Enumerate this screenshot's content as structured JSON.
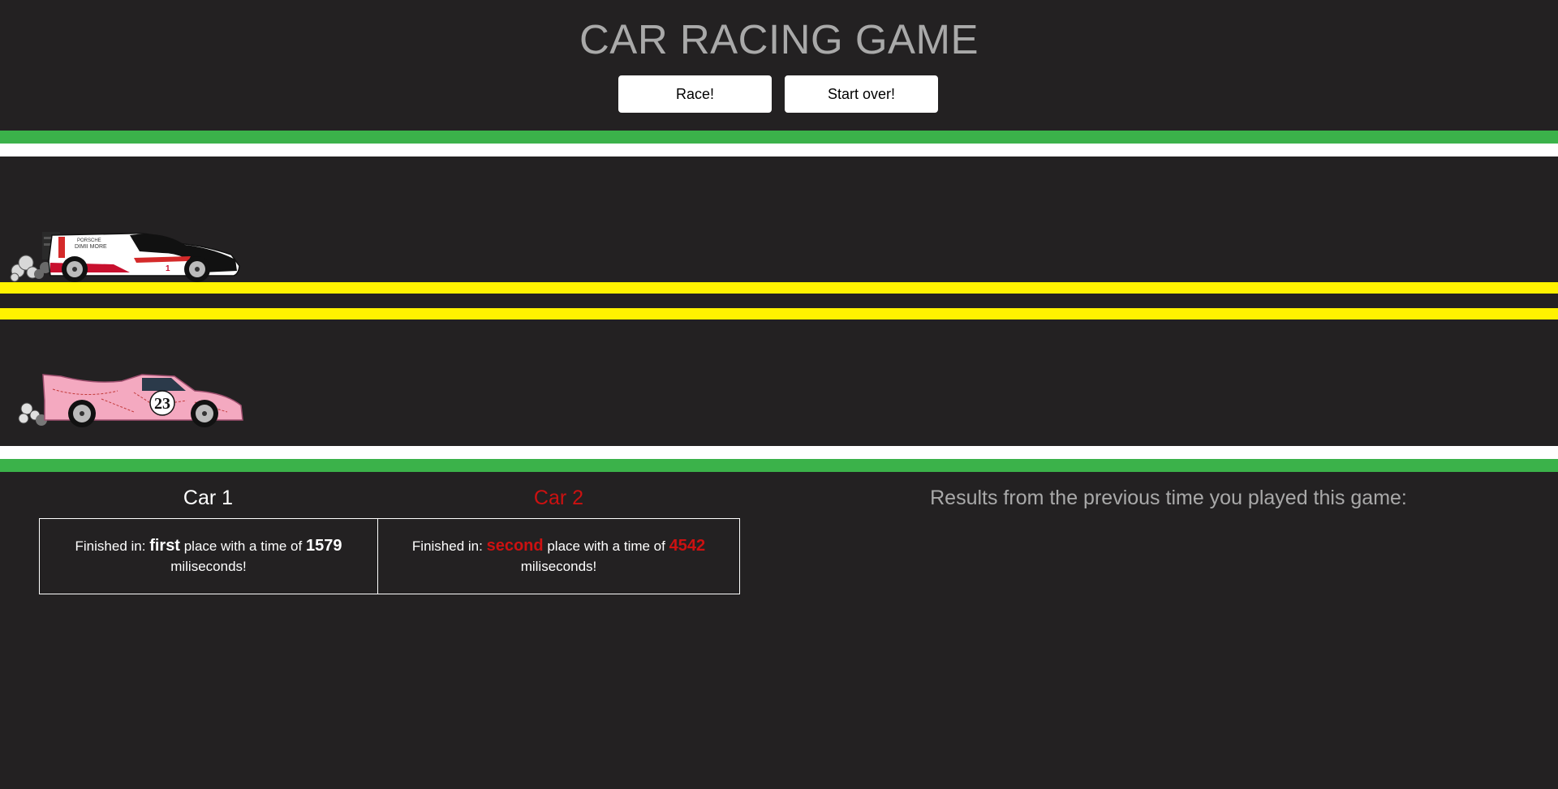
{
  "header": {
    "title": "CAR RACING GAME",
    "race_button": "Race!",
    "start_over_button": "Start over!"
  },
  "track": {
    "colors": {
      "grass": "#3bb24a",
      "edge_line": "#ffffff",
      "center_line": "#fff200",
      "asphalt": "#232122"
    },
    "cars": [
      {
        "icon": "porsche-919-race-car-icon",
        "number": "1",
        "livery_text": "DIMII MORE"
      },
      {
        "icon": "pink-pig-race-car-icon",
        "number": "23"
      }
    ]
  },
  "results": {
    "car1": {
      "heading": "Car 1",
      "prefix": "Finished in:",
      "place": "first",
      "middle": "place with a time of",
      "time": "1579",
      "suffix": "miliseconds!"
    },
    "car2": {
      "heading": "Car 2",
      "prefix": "Finished in:",
      "place": "second",
      "middle": "place with a time of",
      "time": "4542",
      "suffix": "miliseconds!"
    },
    "previous_heading": "Results from the previous time you played this game:"
  }
}
